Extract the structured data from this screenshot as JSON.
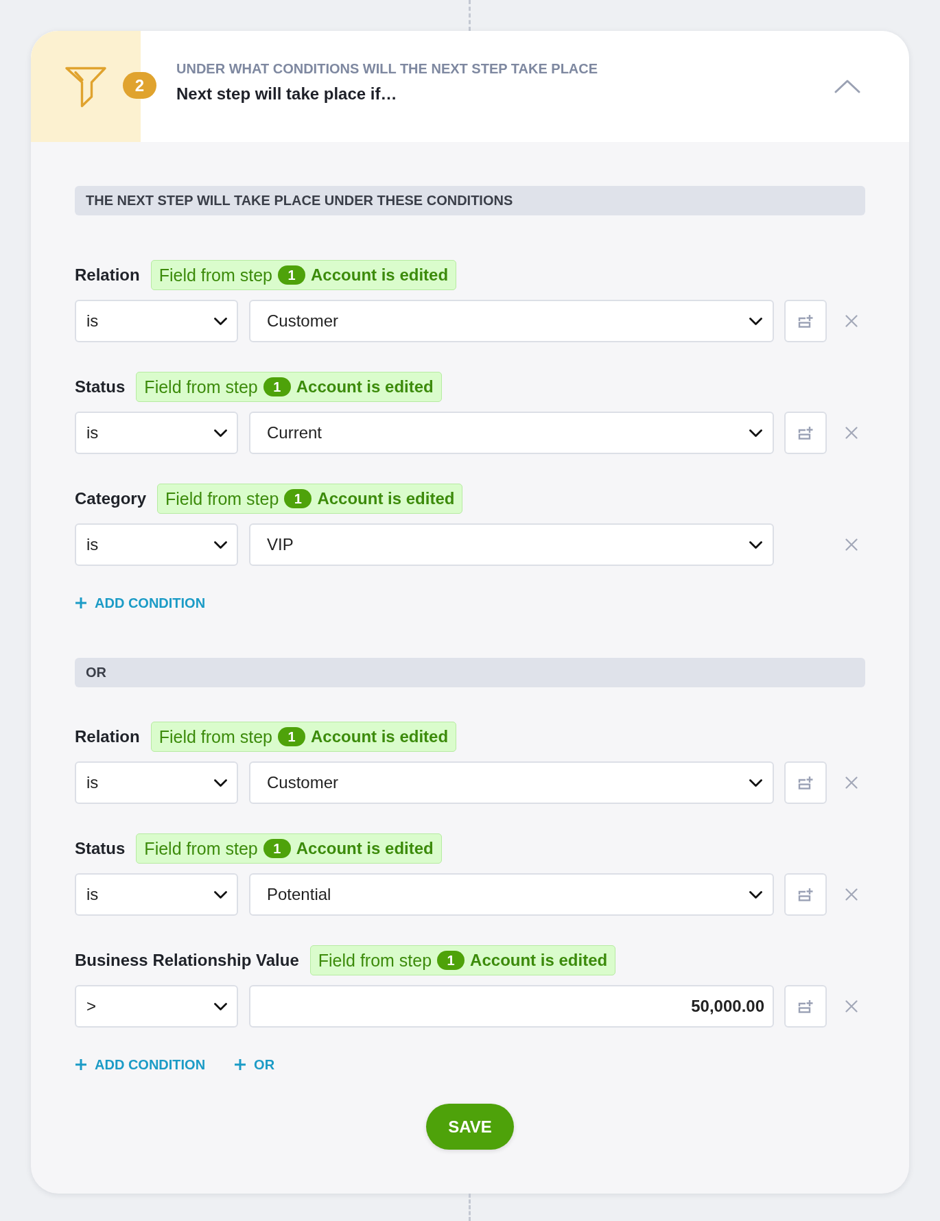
{
  "header": {
    "step_number": "2",
    "subtitle": "UNDER WHAT CONDITIONS WILL THE NEXT STEP TAKE PLACE",
    "title": "Next step will take place if…",
    "expanded": true
  },
  "groups": [
    {
      "heading": "THE NEXT STEP WILL TAKE PLACE UNDER THESE CONDITIONS",
      "conditions": [
        {
          "label": "Relation",
          "source": {
            "prefix": "Field from step",
            "step": "1",
            "event": "Account is edited"
          },
          "operator": "is",
          "value": {
            "kind": "select",
            "text": "Customer"
          },
          "field_button": true
        },
        {
          "label": "Status",
          "source": {
            "prefix": "Field from step",
            "step": "1",
            "event": "Account is edited"
          },
          "operator": "is",
          "value": {
            "kind": "select",
            "text": "Current"
          },
          "field_button": true
        },
        {
          "label": "Category",
          "source": {
            "prefix": "Field from step",
            "step": "1",
            "event": "Account is edited"
          },
          "operator": "is",
          "value": {
            "kind": "select",
            "text": "VIP"
          },
          "field_button": false
        }
      ],
      "actions": [
        "ADD CONDITION"
      ]
    },
    {
      "heading": "OR",
      "conditions": [
        {
          "label": "Relation",
          "source": {
            "prefix": "Field from step",
            "step": "1",
            "event": "Account is edited"
          },
          "operator": "is",
          "value": {
            "kind": "select",
            "text": "Customer"
          },
          "field_button": true
        },
        {
          "label": "Status",
          "source": {
            "prefix": "Field from step",
            "step": "1",
            "event": "Account is edited"
          },
          "operator": "is",
          "value": {
            "kind": "select",
            "text": "Potential"
          },
          "field_button": true
        },
        {
          "label": "Business Relationship Value",
          "source": {
            "prefix": "Field from step",
            "step": "1",
            "event": "Account is edited"
          },
          "operator": ">",
          "value": {
            "kind": "input",
            "text": "50,000.00"
          },
          "field_button": true
        }
      ],
      "actions": [
        "ADD CONDITION",
        "OR"
      ]
    }
  ],
  "save_button": "SAVE"
}
